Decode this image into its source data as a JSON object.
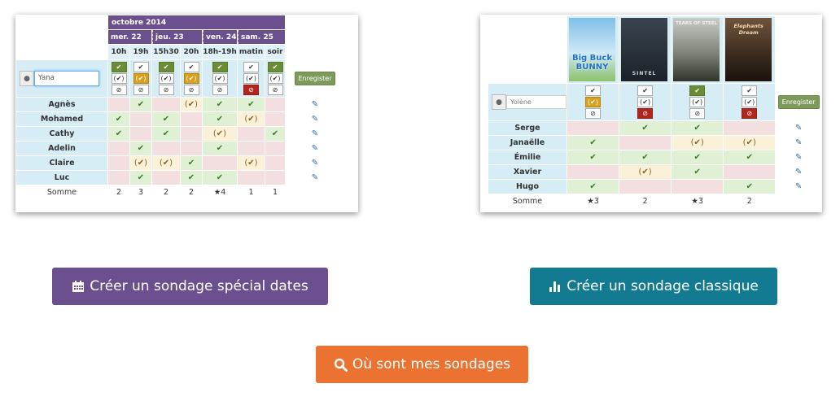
{
  "dates_poll": {
    "month": "octobre 2014",
    "days": [
      "mer. 22",
      "jeu. 23",
      "ven. 24",
      "sam. 25"
    ],
    "hours": [
      "10h",
      "19h",
      "15h30",
      "20h",
      "18h-19h",
      "matin",
      "soir"
    ],
    "input_value": "Yana",
    "save_label": "Enregister",
    "participants": [
      {
        "name": "Agnès",
        "votes": [
          "no",
          "yes",
          "no",
          "maybe",
          "yes",
          "yes",
          "no"
        ]
      },
      {
        "name": "Mohamed",
        "votes": [
          "yes",
          "no",
          "yes",
          "no",
          "yes",
          "maybe",
          "no"
        ]
      },
      {
        "name": "Cathy",
        "votes": [
          "yes",
          "no",
          "yes",
          "no",
          "maybe",
          "no",
          "yes"
        ]
      },
      {
        "name": "Adelin",
        "votes": [
          "no",
          "yes",
          "no",
          "no",
          "yes",
          "no",
          "no"
        ]
      },
      {
        "name": "Claire",
        "votes": [
          "no",
          "maybe",
          "maybe",
          "yes",
          "no",
          "maybe",
          "no"
        ]
      },
      {
        "name": "Luc",
        "votes": [
          "no",
          "yes",
          "no",
          "yes",
          "yes",
          "no",
          "no"
        ]
      }
    ],
    "sum_label": "Somme",
    "sums": [
      "2",
      "3",
      "2",
      "2",
      "★4",
      "1",
      "1"
    ]
  },
  "classic_poll": {
    "posters": [
      {
        "title": "Big Buck BUNNY",
        "class": "p1"
      },
      {
        "title": "SINTEL",
        "class": "p2"
      },
      {
        "title": "TEARS OF STEEL",
        "class": "p3"
      },
      {
        "title": "Elephants Dream",
        "class": "p4"
      }
    ],
    "input_placeholder": "Yolène",
    "save_label": "Enregister",
    "participants": [
      {
        "name": "Serge",
        "votes": [
          "no",
          "yes",
          "yes",
          "no"
        ]
      },
      {
        "name": "Janaëlle",
        "votes": [
          "yes",
          "no",
          "maybe",
          "maybe"
        ]
      },
      {
        "name": "Émilie",
        "votes": [
          "yes",
          "yes",
          "yes",
          "yes"
        ]
      },
      {
        "name": "Xavier",
        "votes": [
          "no",
          "maybe",
          "yes",
          "no"
        ]
      },
      {
        "name": "Hugo",
        "votes": [
          "yes",
          "no",
          "no",
          "yes"
        ]
      }
    ],
    "sum_label": "Somme",
    "sums": [
      "★3",
      "2",
      "★3",
      "2"
    ]
  },
  "buttons": {
    "dates": "Créer un sondage spécial dates",
    "classic": "Créer un sondage classique",
    "find": "Où sont mes sondages"
  },
  "icons": {
    "check": "✔",
    "check_maybe": "(✔)",
    "ban": "⊘",
    "pencil": "✎",
    "user": "👤",
    "calendar": "calendar-icon",
    "bars": "bar-chart-icon",
    "search": "search-icon"
  },
  "colors": {
    "purple": "#6b4f8f",
    "teal": "#137b91",
    "orange": "#ec7232",
    "yes_bg": "#dff0d4",
    "no_bg": "#f3dfdf",
    "maybe_bg": "#fbf0d8"
  }
}
